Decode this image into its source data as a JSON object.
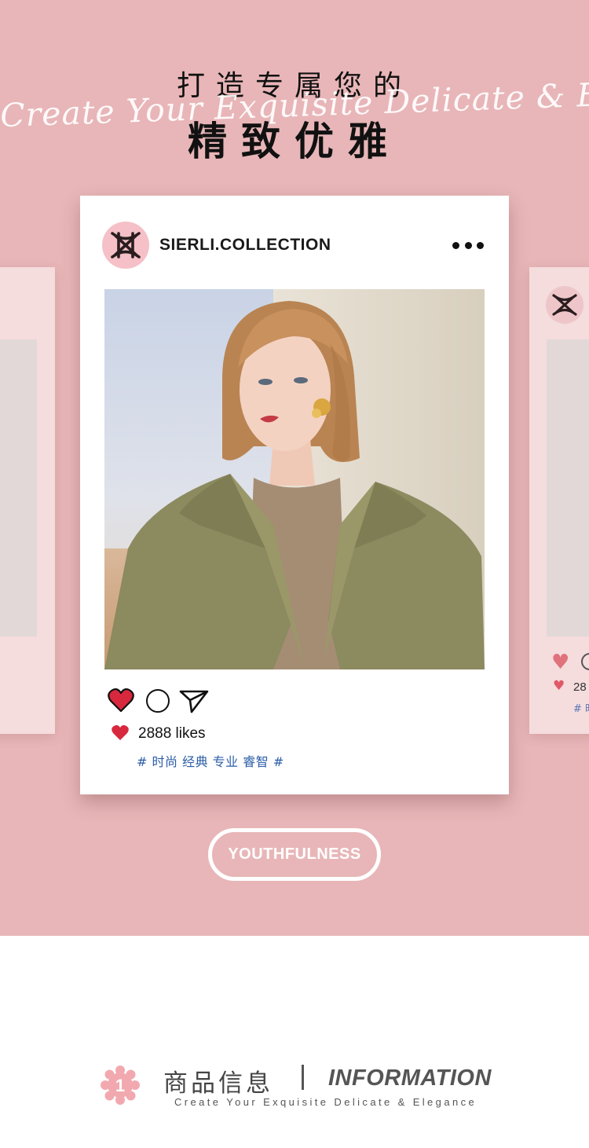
{
  "hero": {
    "title_line1": "打造专属您的",
    "script_text": "Create Your Exquisite Delicate & Elegance",
    "title_line2": "精致优雅"
  },
  "post": {
    "account_name": "SIERLI.COLLECTION",
    "more_icon": "more-dots-icon",
    "photo_alt": "",
    "likes_text": "2888 likes",
    "hashtags": "# 时尚 经典 专业 睿智 #",
    "icons": [
      "heart-icon",
      "comment-icon",
      "share-icon"
    ]
  },
  "side_card": {
    "likes_text": "28",
    "hashtags": "# 时"
  },
  "pill": {
    "label": "YOUTHFULNESS"
  },
  "info": {
    "badge_number": "1",
    "title_cn": "商品信息",
    "title_en": "INFORMATION",
    "subtitle": "Create Your Exquisite Delicate & Elegance"
  },
  "colors": {
    "hero_bg": "#e8b6b8",
    "heart_red": "#d8283e",
    "hashtag_blue": "#2c5ea8",
    "logo_pink": "#f5c0c7"
  }
}
